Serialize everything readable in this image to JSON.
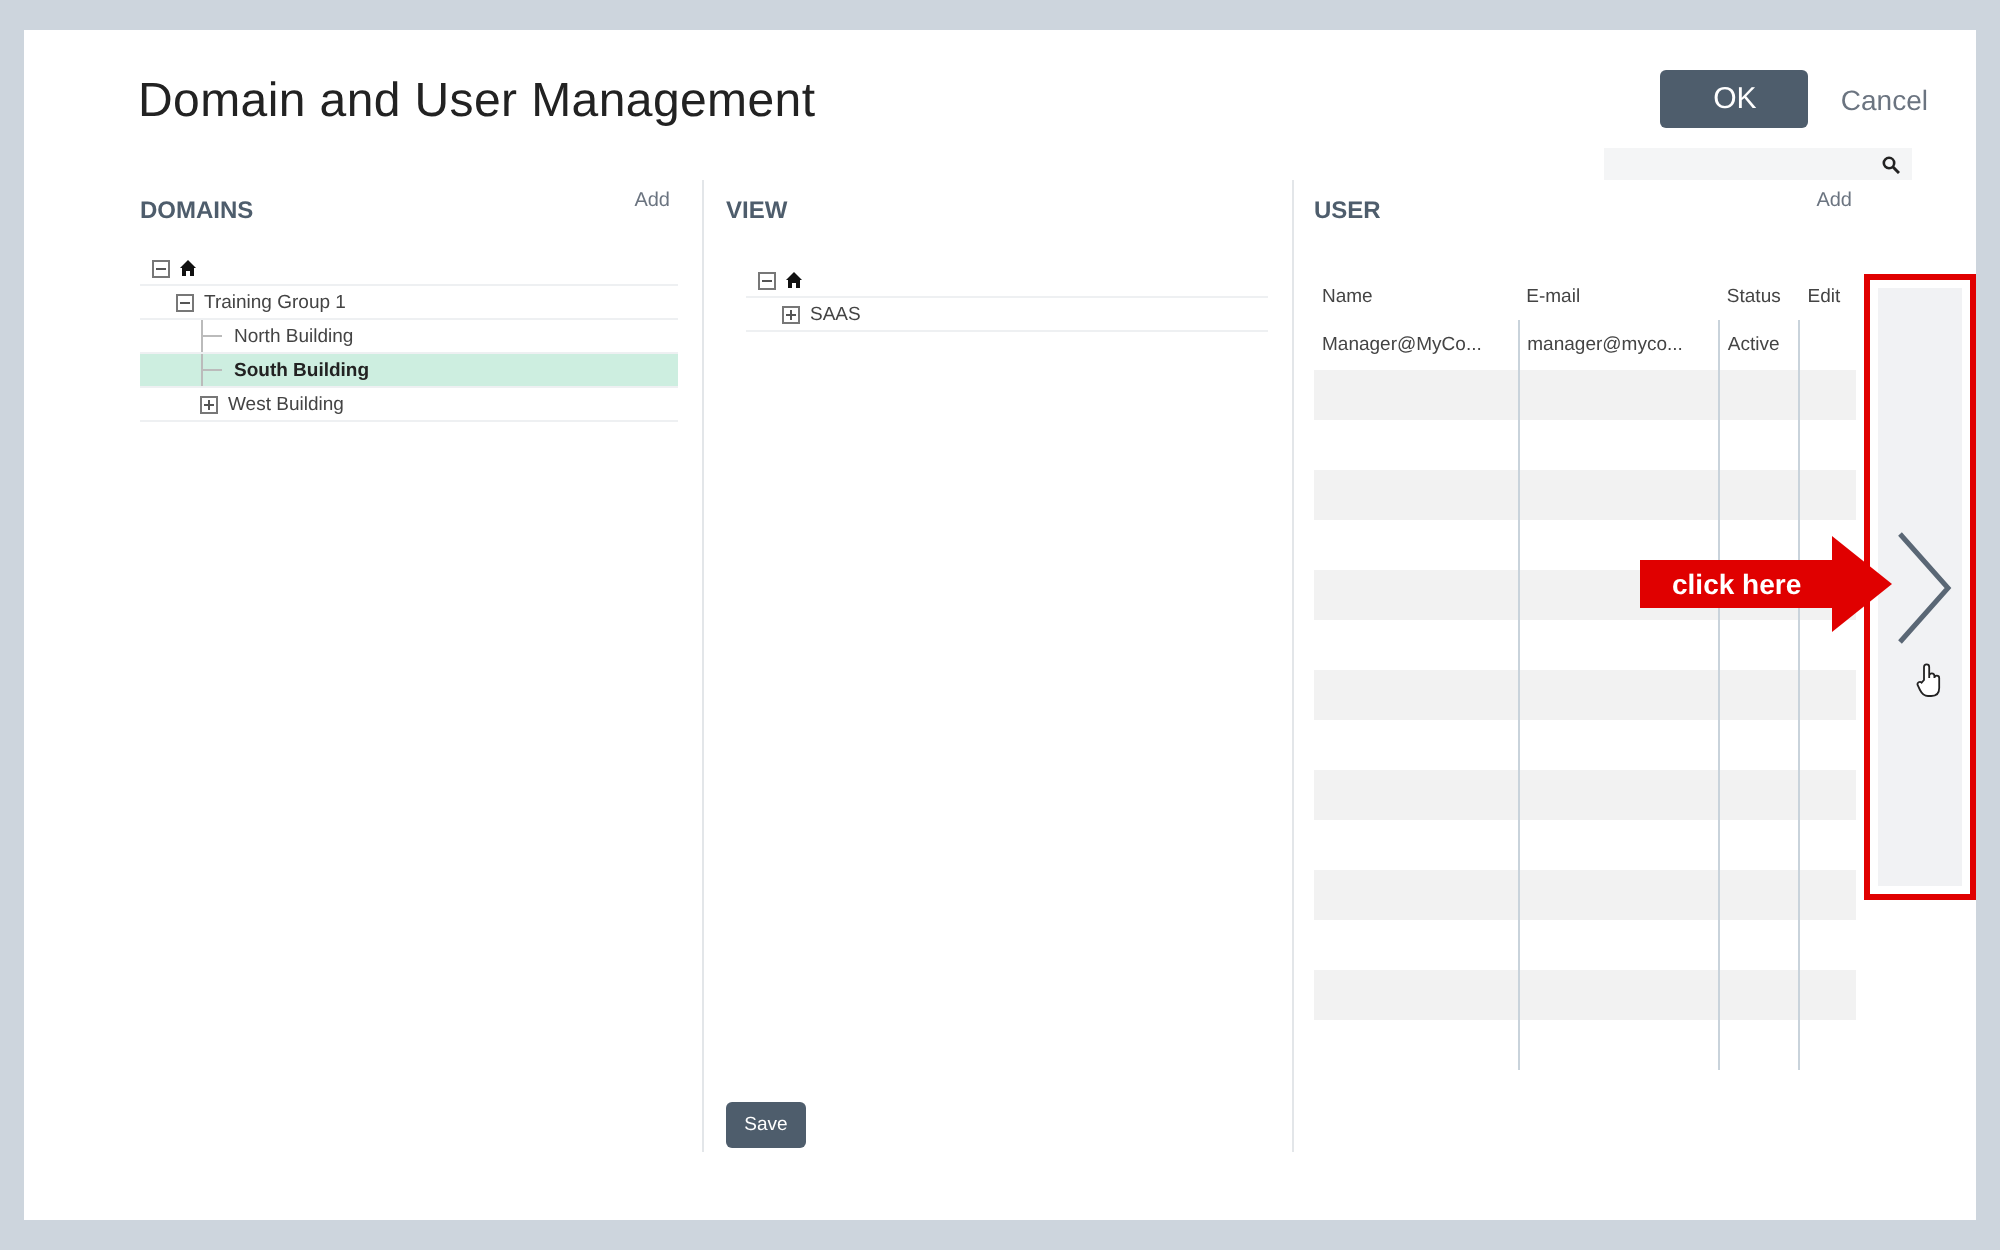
{
  "title": "Domain and User Management",
  "actions": {
    "ok": "OK",
    "cancel": "Cancel"
  },
  "domains": {
    "heading": "DOMAINS",
    "add": "Add",
    "tree": [
      {
        "kind": "home",
        "expanded": true,
        "selected": false,
        "children": [
          {
            "label": "Training Group 1",
            "expanded": true,
            "selected": false,
            "children": [
              {
                "label": "North Building",
                "selected": false
              },
              {
                "label": "South Building",
                "selected": true
              },
              {
                "label": "West Building",
                "expanded": false,
                "selected": false
              }
            ]
          }
        ]
      }
    ]
  },
  "view": {
    "heading": "VIEW",
    "tree": [
      {
        "kind": "home",
        "expanded": true,
        "selected": false,
        "children": [
          {
            "label": "SAAS",
            "expanded": false,
            "selected": false
          }
        ]
      }
    ],
    "save": "Save"
  },
  "user": {
    "heading": "USER",
    "add": "Add",
    "columns": [
      "Name",
      "E-mail",
      "Status",
      "Edit"
    ],
    "rows": [
      [
        "Manager@MyCo...",
        "manager@myco...",
        "Active",
        ""
      ]
    ]
  },
  "callout": {
    "text": "click here"
  }
}
